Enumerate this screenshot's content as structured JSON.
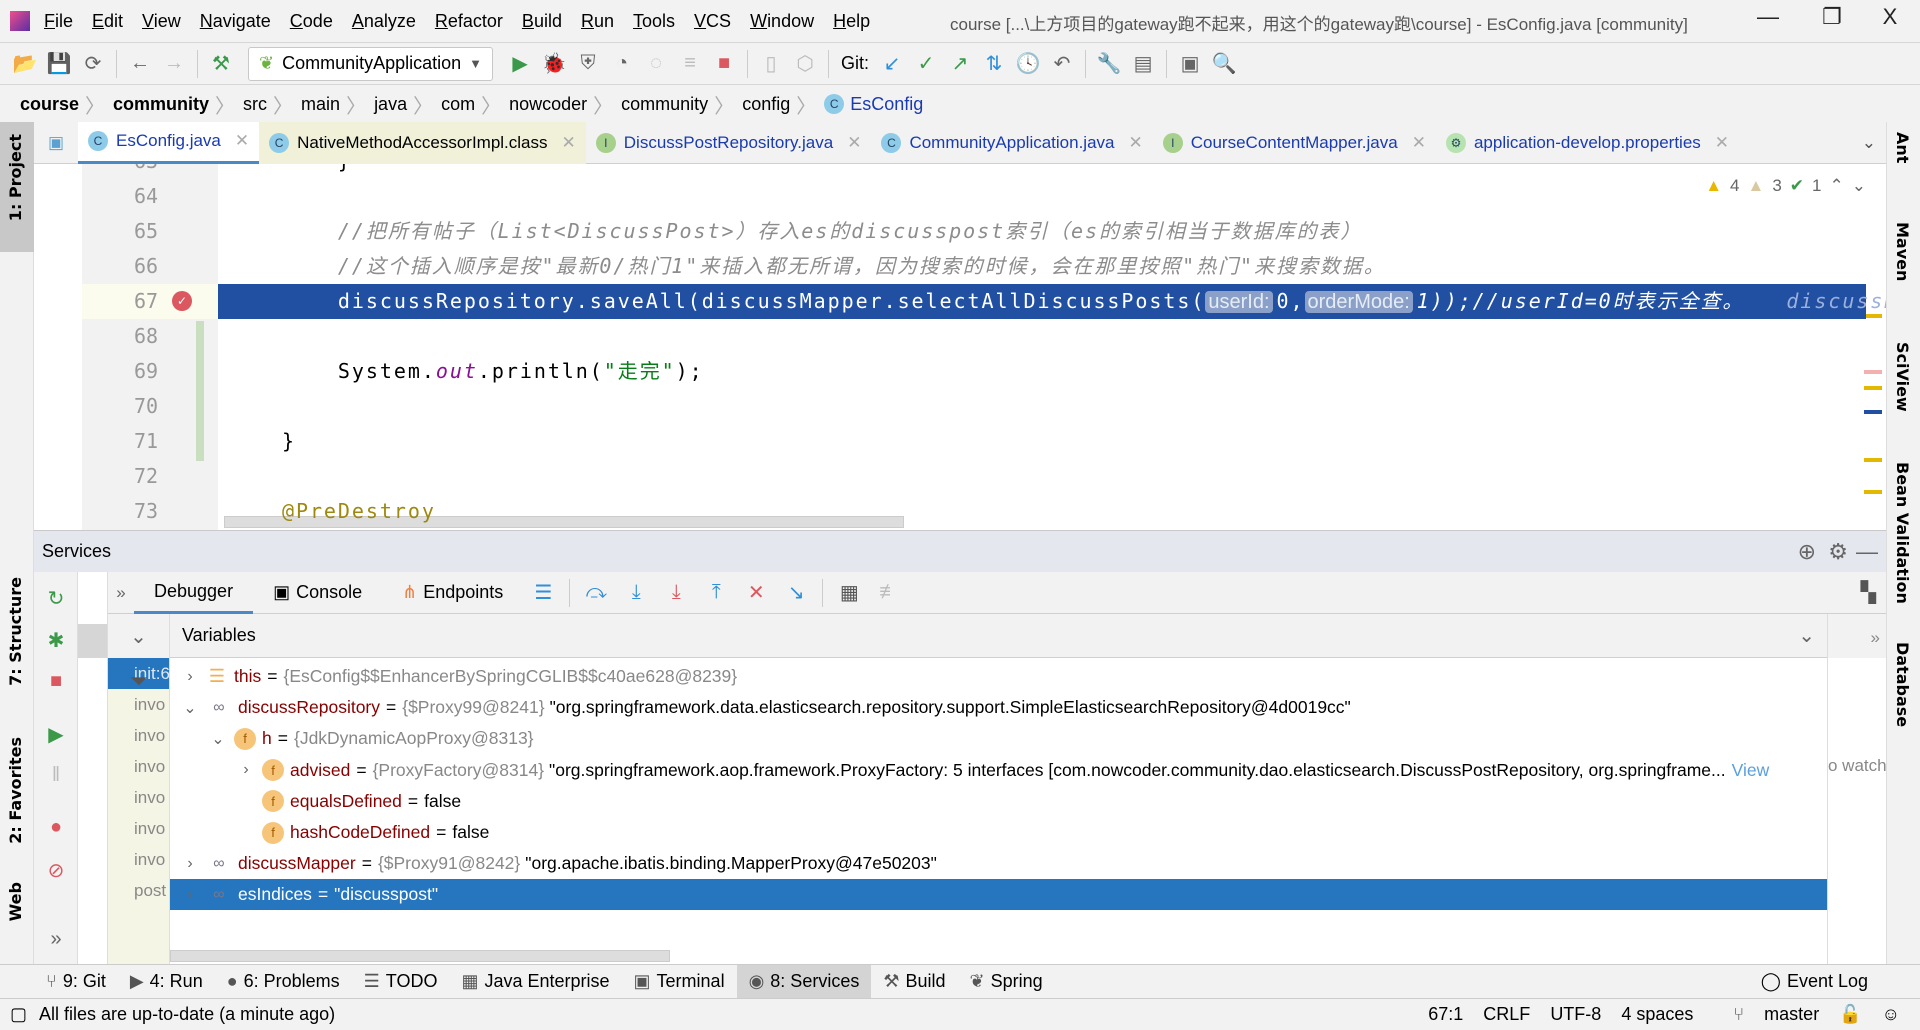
{
  "window": {
    "title": "course [...\\上方项目的gateway跑不起来，用这个的gateway跑\\course] - EsConfig.java [community]",
    "minimize": "—",
    "restore": "❐",
    "close": "X"
  },
  "menu": [
    "File",
    "Edit",
    "View",
    "Navigate",
    "Code",
    "Analyze",
    "Refactor",
    "Build",
    "Run",
    "Tools",
    "VCS",
    "Window",
    "Help"
  ],
  "toolbar": {
    "run_config": "CommunityApplication",
    "git_label": "Git:"
  },
  "breadcrumb": [
    "course",
    "community",
    "src",
    "main",
    "java",
    "com",
    "nowcoder",
    "community",
    "config",
    "EsConfig"
  ],
  "tabs": [
    {
      "label": "EsConfig.java",
      "icon": "C",
      "kind": "class",
      "active": true
    },
    {
      "label": "NativeMethodAccessorImpl.class",
      "icon": "C",
      "kind": "class-file"
    },
    {
      "label": "DiscussPostRepository.java",
      "icon": "I",
      "kind": "interface"
    },
    {
      "label": "CommunityApplication.java",
      "icon": "C",
      "kind": "class"
    },
    {
      "label": "CourseContentMapper.java",
      "icon": "I",
      "kind": "interface"
    },
    {
      "label": "application-develop.properties",
      "icon": "⚙",
      "kind": "spring"
    }
  ],
  "inspections": {
    "warnings": "4",
    "weak_warnings": "3",
    "typos": "1"
  },
  "editor": {
    "current_line": 67,
    "lines": [
      {
        "n": "63",
        "seg": [
          {
            "t": "        }",
            "c": ""
          }
        ]
      },
      {
        "n": "64",
        "seg": []
      },
      {
        "n": "65",
        "seg": [
          {
            "t": "        //把所有帖子（List<DiscussPost>）存入es的discusspost索引（es的索引相当于数据库的表）",
            "c": "cmt"
          }
        ]
      },
      {
        "n": "66",
        "seg": [
          {
            "t": "        //这个插入顺序是按\"最新0/热门1\"来插入都无所谓，因为搜索的时候，会在那里按照\"热门\"来搜索数据。",
            "c": "cmt"
          }
        ]
      },
      {
        "n": "67",
        "seg": [
          {
            "t": "        discussRepository.saveAll(discussMapper.selectAllDiscussPosts(",
            "c": ""
          },
          {
            "t": "userId:",
            "c": "hint"
          },
          {
            "t": "0,",
            "c": ""
          },
          {
            "t": "orderMode:",
            "c": "hint"
          },
          {
            "t": "1));//userId=0时表示全查。   ",
            "c": "ital"
          },
          {
            "t": "discussRepository: \"org.springframework...\"",
            "c": "dbgval"
          }
        ]
      },
      {
        "n": "68",
        "seg": []
      },
      {
        "n": "69",
        "seg": [
          {
            "t": "        System.",
            "c": ""
          },
          {
            "t": "out",
            "c": "kw-out"
          },
          {
            "t": ".println(",
            "c": ""
          },
          {
            "t": "\"走完\"",
            "c": "str"
          },
          {
            "t": ");",
            "c": ""
          }
        ]
      },
      {
        "n": "70",
        "seg": []
      },
      {
        "n": "71",
        "seg": [
          {
            "t": "    }",
            "c": ""
          }
        ]
      },
      {
        "n": "72",
        "seg": []
      },
      {
        "n": "73",
        "seg": [
          {
            "t": "    @PreDestroy",
            "c": "ann"
          }
        ]
      }
    ]
  },
  "services": {
    "title": "Services",
    "tabs": [
      "Debugger",
      "Console",
      "Endpoints"
    ],
    "variables_title": "Variables",
    "frames": [
      "init:6",
      "invo",
      "invo",
      "invo",
      "invo",
      "invo",
      "invo",
      "post"
    ],
    "watches_hint": "o watch",
    "variables": [
      {
        "level": 0,
        "exp": ">",
        "icon": "lines",
        "name": "this",
        "ref": "{EsConfig$$EnhancerBySpringCGLIB$$c40ae628@8239}",
        "val": ""
      },
      {
        "level": 0,
        "exp": "v",
        "icon": "oo",
        "name": "discussRepository",
        "ref": "{$Proxy99@8241}",
        "val": "\"org.springframework.data.elasticsearch.repository.support.SimpleElasticsearchRepository@4d0019cc\""
      },
      {
        "level": 1,
        "exp": "v",
        "icon": "f",
        "name": "h",
        "ref": "{JdkDynamicAopProxy@8313}",
        "val": ""
      },
      {
        "level": 2,
        "exp": ">",
        "icon": "f",
        "name": "advised",
        "ref": "{ProxyFactory@8314}",
        "val": "\"org.springframework.aop.framework.ProxyFactory: 5 interfaces [com.nowcoder.community.dao.elasticsearch.DiscussPostRepository, org.springframe...",
        "link": "View"
      },
      {
        "level": 2,
        "exp": "",
        "icon": "f",
        "name": "equalsDefined",
        "ref": "",
        "val": "false"
      },
      {
        "level": 2,
        "exp": "",
        "icon": "f",
        "name": "hashCodeDefined",
        "ref": "",
        "val": "false"
      },
      {
        "level": 0,
        "exp": ">",
        "icon": "oo",
        "name": "discussMapper",
        "ref": "{$Proxy91@8242}",
        "val": "\"org.apache.ibatis.binding.MapperProxy@47e50203\""
      },
      {
        "level": 0,
        "exp": ">",
        "icon": "oo",
        "name": "esIndices",
        "ref": "",
        "val": "\"discusspost\"",
        "selected": true
      }
    ]
  },
  "left_stripe": [
    "1: Project",
    "7: Structure",
    "2: Favorites",
    "Web"
  ],
  "right_stripe": [
    "Ant",
    "Maven",
    "SciView",
    "Bean Validation",
    "Database"
  ],
  "bottom_tabs": [
    {
      "label": "9: Git",
      "icon": "⑂"
    },
    {
      "label": "4: Run",
      "icon": "▶"
    },
    {
      "label": "6: Problems",
      "icon": "●"
    },
    {
      "label": "TODO",
      "icon": "☰"
    },
    {
      "label": "Java Enterprise",
      "icon": "▦"
    },
    {
      "label": "Terminal",
      "icon": "▣"
    },
    {
      "label": "8: Services",
      "icon": "◉",
      "active": true
    },
    {
      "label": "Build",
      "icon": "⚒"
    },
    {
      "label": "Spring",
      "icon": "❦"
    }
  ],
  "event_log": "Event Log",
  "status": {
    "message": "All files are up-to-date (a minute ago)",
    "position": "67:1",
    "line_sep": "CRLF",
    "encoding": "UTF-8",
    "indent": "4 spaces",
    "branch": "master"
  },
  "colors": {
    "exec_line": "#2150a3",
    "selection": "#2675bf",
    "accent": "#4a88c7"
  }
}
